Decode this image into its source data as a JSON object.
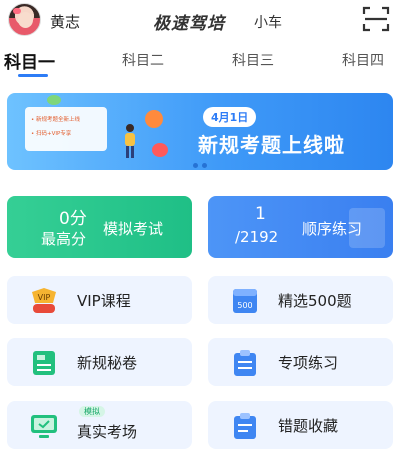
{
  "header": {
    "username": "黄志",
    "brand": "极速驾培",
    "brand_sub": "小车"
  },
  "tabs": [
    {
      "label": "科目一",
      "active": true
    },
    {
      "label": "科目二",
      "active": false
    },
    {
      "label": "科目三",
      "active": false
    },
    {
      "label": "科目四",
      "active": false
    }
  ],
  "banner": {
    "date": "4月1日",
    "headline": "新规考题上线啦",
    "panel_lines": [
      "• 新规考题全新上线",
      "• 扫码+VIP专享"
    ]
  },
  "cards": {
    "mock": {
      "score": "0分",
      "score_label": "最高分",
      "label": "模拟考试"
    },
    "sequential": {
      "progress": "1",
      "total": "/2192",
      "label": "顺序练习"
    }
  },
  "grid": [
    {
      "label": "VIP课程",
      "icon": "vip-icon"
    },
    {
      "label": "精选500题",
      "icon": "book-500-icon"
    },
    {
      "label": "新规秘卷",
      "icon": "new-paper-icon"
    },
    {
      "label": "专项练习",
      "icon": "clipboard-icon"
    },
    {
      "label": "真实考场",
      "icon": "monitor-icon",
      "tag": "模拟"
    },
    {
      "label": "错题收藏",
      "icon": "clipboard-list-icon"
    }
  ],
  "colors": {
    "accent": "#2d7cf6",
    "green": "#1fbf86",
    "card_bg": "#eef4ff"
  }
}
